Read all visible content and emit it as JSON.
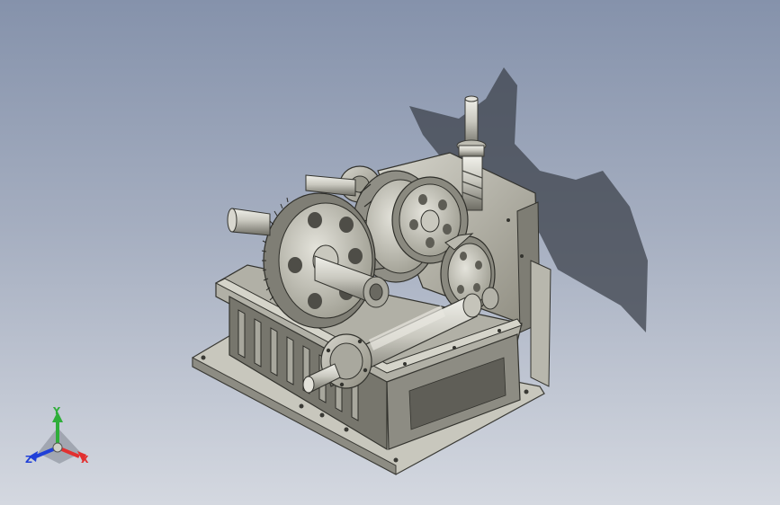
{
  "viewport": {
    "background_top": "#8592ab",
    "background_bottom": "#d4d8e0"
  },
  "model": {
    "name_icon": "gearbox-assembly-3d-model",
    "parts": [
      "housing",
      "base-flange",
      "input-shaft",
      "output-shaft",
      "large-spur-gear",
      "helical-gear",
      "bevel-gear",
      "worm-shaft",
      "shadow"
    ]
  },
  "triad": {
    "x_label": "X",
    "y_label": "Y",
    "z_label": "Z",
    "x_color": "#e23030",
    "y_color": "#2fae3a",
    "z_color": "#2040d8"
  }
}
